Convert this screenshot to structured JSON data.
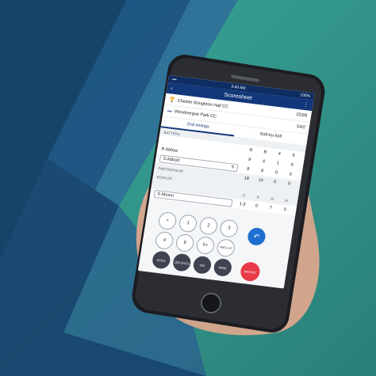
{
  "status": {
    "time": "3:40 AM",
    "battery": "100%"
  },
  "appbar": {
    "title": "Scoresheet",
    "back_icon": "chevron-left-icon",
    "menu_icon": "more-vertical-icon"
  },
  "teams": [
    {
      "name": "Chester Boughton Hall CC",
      "score": "220/8",
      "icon": "trophy-icon"
    },
    {
      "name": "Woodvergue Park CC",
      "score": "54/2",
      "icon": "bat-icon"
    }
  ],
  "tabs": [
    {
      "label": "2nd Innings"
    },
    {
      "label": "Ball-by-ball"
    }
  ],
  "batters_label": "BATTERS",
  "batters_cols": [
    "R",
    "B",
    "4",
    "6"
  ],
  "batters": [
    {
      "name": "R Abbas",
      "values": [
        "9",
        "4",
        "1",
        "6"
      ]
    },
    {
      "name": "S Abbott",
      "values": [
        "8",
        "8",
        "0",
        "0"
      ]
    },
    {
      "name": "PARTNERSHIP",
      "values": [
        "18",
        "14",
        "0",
        "0"
      ]
    }
  ],
  "bowler_label": "BOWLER",
  "bowler_cols": [
    "O",
    "R",
    "W",
    "M"
  ],
  "bowler": {
    "name": "S Abunn",
    "values": [
      "1.3",
      "0",
      "7",
      "0"
    ]
  },
  "keys": {
    "row1": [
      "•",
      "1",
      "2",
      "3"
    ],
    "row2": [
      "4",
      "6",
      "5+",
      "FREE HIT"
    ],
    "row3": [
      "BYES",
      "LEG BYES",
      "NO",
      "WIDE"
    ],
    "undo_icon": "undo-icon",
    "wicket": "WICKET"
  }
}
